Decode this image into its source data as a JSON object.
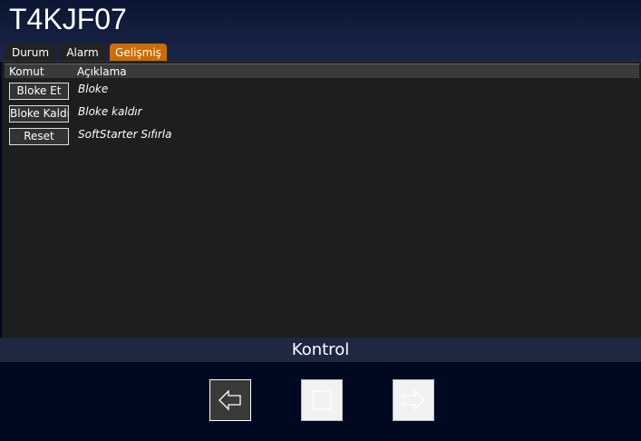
{
  "header": {
    "title": "T4KJF07"
  },
  "tabs": [
    {
      "label": "Durum"
    },
    {
      "label": "Alarm"
    },
    {
      "label": "Gelişmiş",
      "active": true
    }
  ],
  "table": {
    "columns": [
      "Komut",
      "Açıklama"
    ],
    "rows": [
      {
        "command": "Bloke Et",
        "description": "Bloke"
      },
      {
        "command": "Bloke Kaldır",
        "description": "Bloke kaldır"
      },
      {
        "command": "Reset",
        "description": "SoftStarter Sıfırla"
      }
    ]
  },
  "footer": {
    "title": "Kontrol",
    "buttons": [
      {
        "icon": "arrow-left-icon"
      },
      {
        "icon": "stop-icon"
      },
      {
        "icon": "arrow-right-icon"
      }
    ]
  },
  "colors": {
    "accent": "#cc6d00",
    "background": "#00091f"
  }
}
